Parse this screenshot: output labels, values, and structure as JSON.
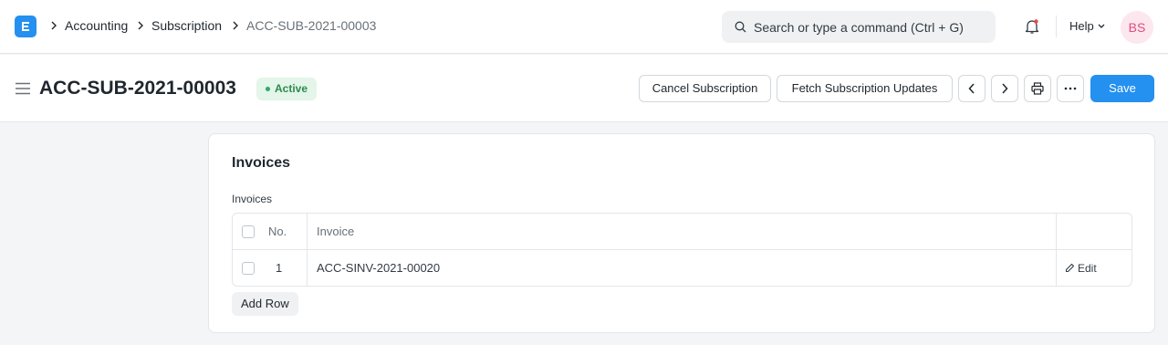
{
  "navbar": {
    "breadcrumbs": [
      "Accounting",
      "Subscription",
      "ACC-SUB-2021-00003"
    ],
    "search_placeholder": "Search or type a command (Ctrl + G)",
    "help_label": "Help",
    "avatar_initials": "BS"
  },
  "page": {
    "title": "ACC-SUB-2021-00003",
    "status": "Active",
    "status_color": "#2d8a4e",
    "buttons": {
      "cancel": "Cancel Subscription",
      "fetch": "Fetch Subscription Updates",
      "save": "Save"
    }
  },
  "section": {
    "title": "Invoices",
    "field_label": "Invoices",
    "columns": {
      "no": "No.",
      "invoice": "Invoice"
    },
    "rows": [
      {
        "no": "1",
        "invoice": "ACC-SINV-2021-00020",
        "edit": "Edit"
      }
    ],
    "add_row": "Add Row"
  },
  "colors": {
    "accent": "#2490ef",
    "background": "#f4f5f6"
  }
}
